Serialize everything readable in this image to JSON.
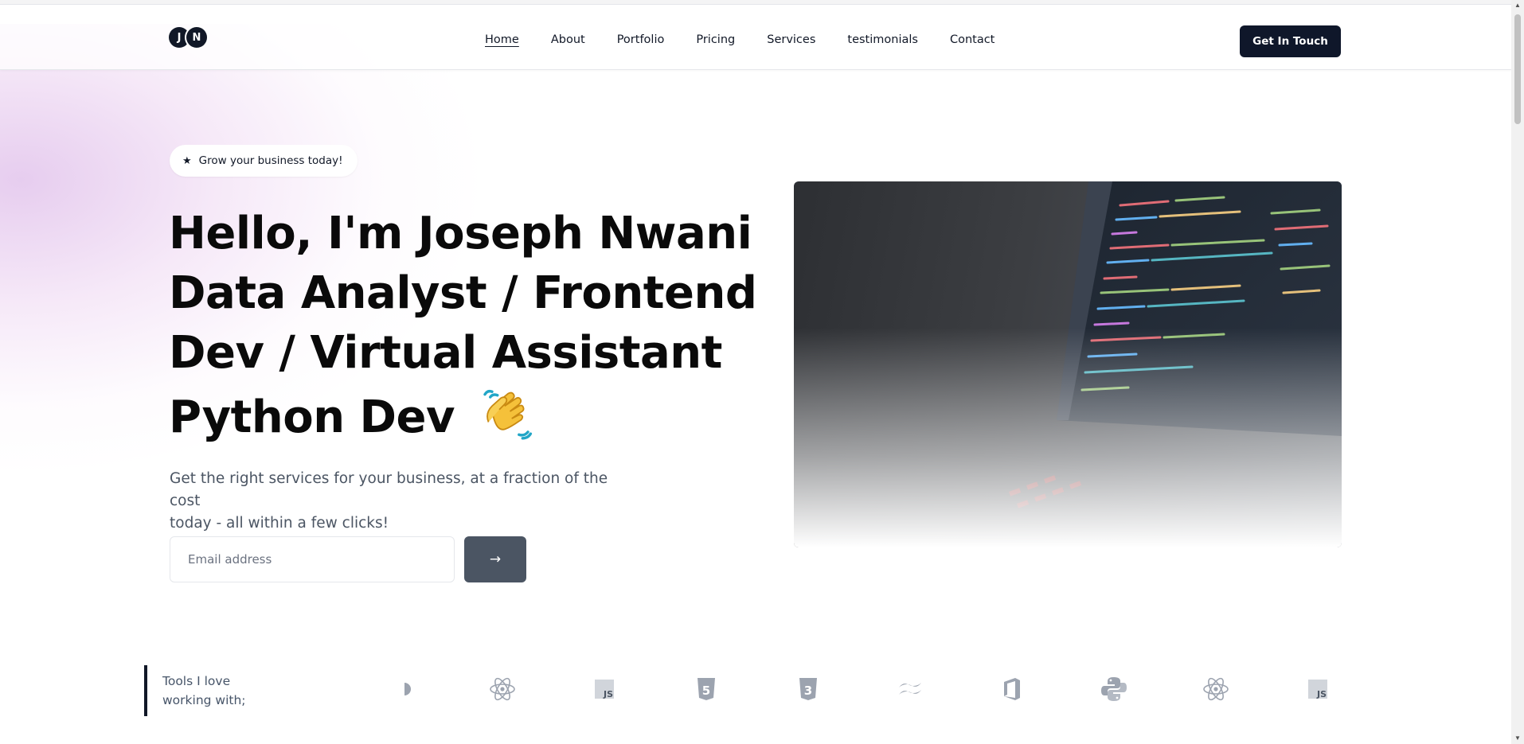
{
  "header": {
    "logo_letters": [
      "J",
      "N"
    ],
    "nav": [
      {
        "label": "Home",
        "active": true
      },
      {
        "label": "About",
        "active": false
      },
      {
        "label": "Portfolio",
        "active": false
      },
      {
        "label": "Pricing",
        "active": false
      },
      {
        "label": "Services",
        "active": false
      },
      {
        "label": "testimonials",
        "active": false
      },
      {
        "label": "Contact",
        "active": false
      }
    ],
    "cta_label": "Get In Touch"
  },
  "hero": {
    "pill_icon": "star-icon",
    "pill_text": "Grow your business today!",
    "title_lines": [
      "Hello, I'm Joseph Nwani",
      "Data Analyst / Frontend",
      "Dev / Virtual Assistant",
      "Python Dev"
    ],
    "title_emoji_icon": "clapping-hands-icon",
    "subtitle_lines": [
      "Get the right services for your business, at a fraction of the cost",
      "today - all within a few clicks!"
    ],
    "email_placeholder": "Email address",
    "email_value": "",
    "submit_label": "→",
    "image_icon": "code-screen-photo"
  },
  "tools": {
    "label_lines": [
      "Tools I love",
      "working with;"
    ],
    "icons": [
      {
        "name": "partial-icon"
      },
      {
        "name": "react-icon"
      },
      {
        "name": "javascript-icon",
        "text": "JS"
      },
      {
        "name": "html5-icon",
        "text": "5"
      },
      {
        "name": "css3-icon",
        "text": "3"
      },
      {
        "name": "tailwind-icon"
      },
      {
        "name": "office-icon"
      },
      {
        "name": "python-icon"
      },
      {
        "name": "react-icon"
      },
      {
        "name": "javascript-icon",
        "text": "JS"
      }
    ]
  },
  "colors": {
    "primary": "#0f172a",
    "submit_button": "#4b5563",
    "tool_icon": "#9ca3af",
    "glow": "#e9c8f0"
  }
}
